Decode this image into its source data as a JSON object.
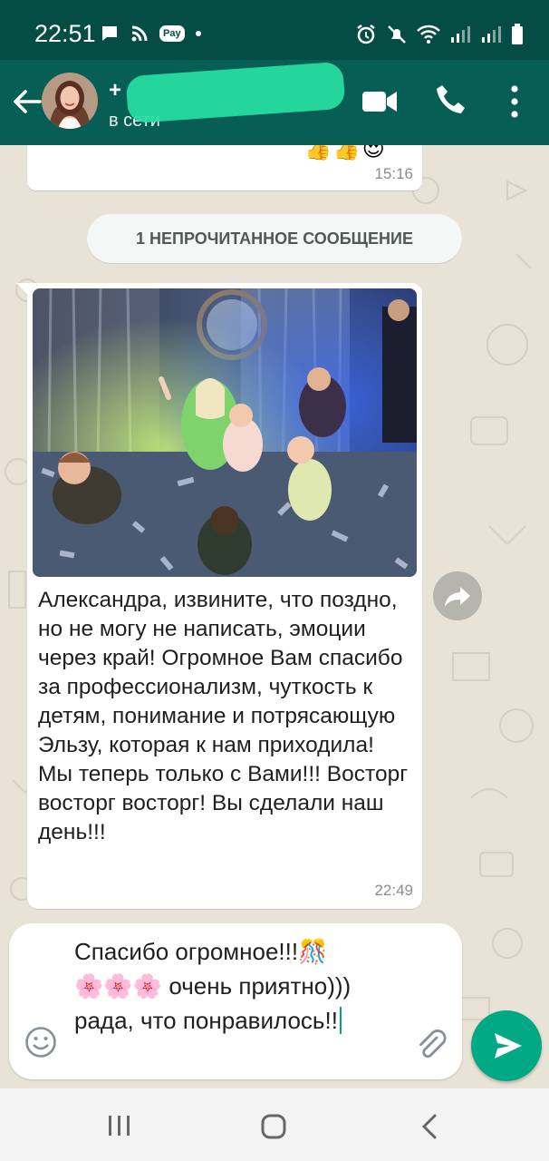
{
  "status_bar": {
    "time": "22:51",
    "pay_label": "Pay"
  },
  "header": {
    "contact_name": "+",
    "contact_status": "в сети"
  },
  "chat": {
    "previous_message": {
      "emojis": "👍👍😍",
      "time": "15:16"
    },
    "unread_divider": "1 НЕПРОЧИТАННОЕ СООБЩЕНИЕ",
    "message": {
      "text": "Александра, извините, что поздно, но не могу не написать, эмоции через край! Огромное Вам спасибо за профессионализм, чуткость к детям, понимание и потрясающую Эльзу, которая к нам приходила! Мы теперь только с Вами!!! Восторг восторг восторг! Вы сделали наш день!!!",
      "time": "22:49"
    }
  },
  "composer": {
    "text": "Спасибо огромное!!!🎊\n🌸🌸🌸 очень приятно))) рада, что понравилось!!"
  },
  "colors": {
    "status_bar": "#054d44",
    "app_bar": "#075e54",
    "send_button": "#00a884",
    "chat_background": "#e9e2d6"
  },
  "icons": {
    "back": "arrow-left-icon",
    "video": "video-camera-icon",
    "call": "phone-icon",
    "menu": "more-vert-icon",
    "forward": "forward-icon",
    "emoji": "smiley-icon",
    "attach": "paperclip-icon",
    "send": "send-icon"
  }
}
